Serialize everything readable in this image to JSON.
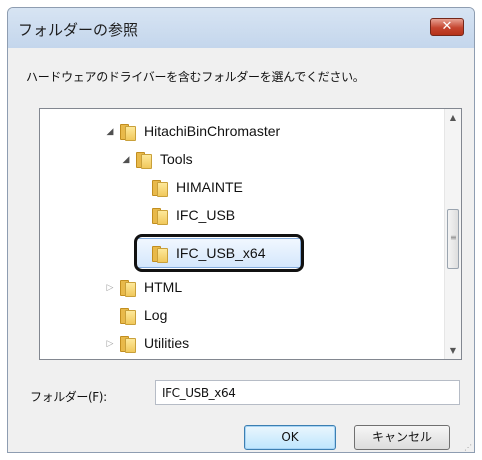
{
  "dialog": {
    "title": "フォルダーの参照",
    "close_label": "✕",
    "instruction": "ハードウェアのドライバーを含むフォルダーを選んでください。"
  },
  "tree": {
    "items": [
      {
        "label": "HitachiBinChromaster",
        "expander": "◢",
        "state": "expanded"
      },
      {
        "label": "Tools",
        "expander": "◢",
        "state": "expanded"
      },
      {
        "label": "HIMAINTE",
        "expander": "",
        "state": "leaf"
      },
      {
        "label": "IFC_USB",
        "expander": "",
        "state": "leaf"
      },
      {
        "label": "IFC_USB_x64",
        "expander": "",
        "state": "selected"
      },
      {
        "label": "HTML",
        "expander": "▷",
        "state": "collapsed"
      },
      {
        "label": "Log",
        "expander": "",
        "state": "leaf"
      },
      {
        "label": "Utilities",
        "expander": "▷",
        "state": "collapsed"
      }
    ]
  },
  "scrollbar": {
    "up_arrow": "▲",
    "down_arrow": "▼",
    "grip": "≡"
  },
  "folder_field": {
    "label": "フォルダー(F):",
    "value": "IFC_USB_x64"
  },
  "buttons": {
    "ok_label": "OK",
    "cancel_label": "キャンセル"
  },
  "colors": {
    "title_bar": "#c4d6ec",
    "close_button": "#c5452f",
    "selection": "#d5e7fc",
    "folder": "#f1c85c"
  }
}
